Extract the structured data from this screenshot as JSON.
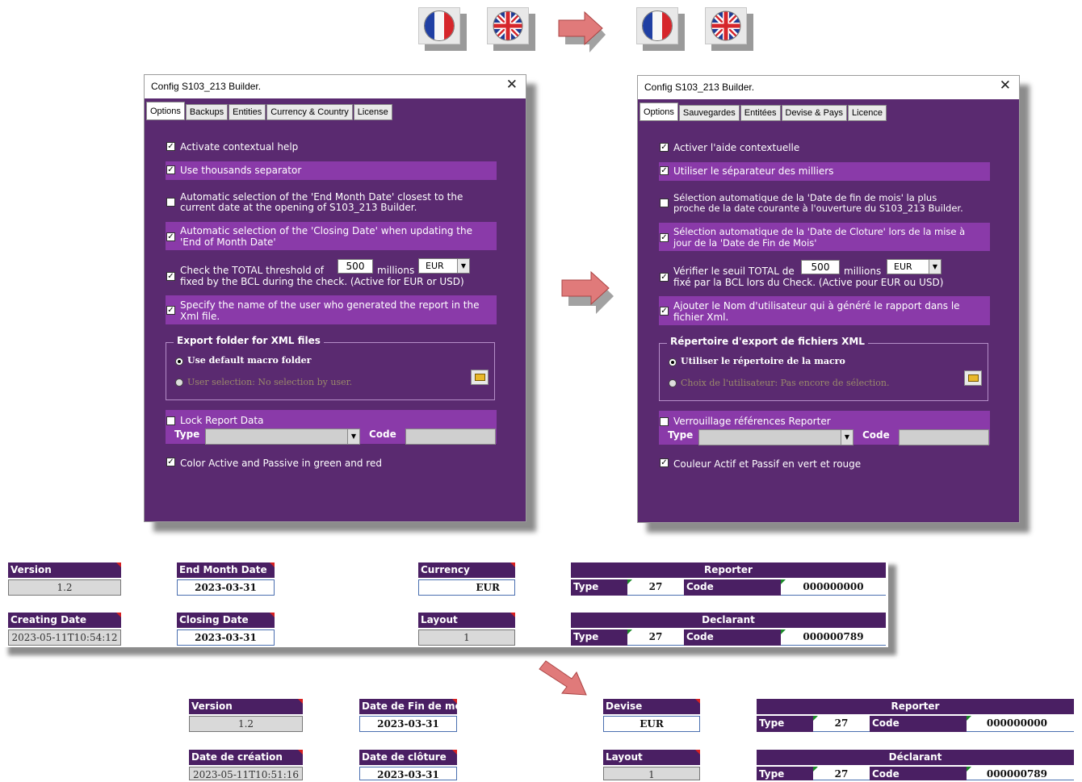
{
  "dialog_en": {
    "title": "Config S103_213 Builder.",
    "close_icon": "close-icon",
    "tabs": [
      "Options",
      "Backups",
      "Entities",
      "Currency & Country",
      "License"
    ],
    "opt_contextual_help": "Activate contextual help",
    "opt_thousands_sep": "Use thousands separator",
    "opt_auto_end_month_1": "Automatic selection of the 'End Month Date' closest to the",
    "opt_auto_end_month_2": "current date at the opening of S103_213 Builder.",
    "opt_auto_closing_1": "Automatic selection of the 'Closing Date' when updating the",
    "opt_auto_closing_2": "'End of Month Date'",
    "opt_threshold_pre": "Check the TOTAL threshold of",
    "threshold_value": "500",
    "opt_threshold_mid": "millions",
    "threshold_currency": "EUR",
    "opt_threshold_2": "fixed by the BCL during the check. (Active for EUR or USD)",
    "opt_user_name_1": "Specify the name of the user who generated the report in the",
    "opt_user_name_2": "Xml file.",
    "export_title": "Export folder for XML files",
    "export_default": "Use default macro folder",
    "export_user": "User selection: No selection by user.",
    "lock_label": "Lock Report Data",
    "type_label": "Type",
    "code_label": "Code",
    "color_label": "Color Active and Passive in green and red"
  },
  "dialog_fr": {
    "title": "Config S103_213 Builder.",
    "tabs": [
      "Options",
      "Sauvegardes",
      "Entitées",
      "Devise & Pays",
      "Licence"
    ],
    "opt_contextual_help": "Activer l'aide contextuelle",
    "opt_thousands_sep": "Utiliser le séparateur des milliers",
    "opt_auto_end_month_1": "Sélection automatique de la  'Date de fin de mois'  la plus",
    "opt_auto_end_month_2": "proche de la date courante à l'ouverture du S103_213 Builder.",
    "opt_auto_closing_1": "Sélection automatique de la 'Date de Cloture' lors de la mise à",
    "opt_auto_closing_2": "jour de la 'Date de Fin de Mois'",
    "opt_threshold_pre": "Vérifier le seuil TOTAL de",
    "threshold_value": "500",
    "opt_threshold_mid": "millions",
    "threshold_currency": "EUR",
    "opt_threshold_2": "fixé par la BCL lors du Check. (Active pour EUR ou USD)",
    "opt_user_name_1": "Ajouter le Nom d'utilisateur qui à généré le rapport dans le",
    "opt_user_name_2": "fichier Xml.",
    "export_title": "Répertoire d'export de fichiers XML",
    "export_default": "Utiliser le répertoire de la macro",
    "export_user": "Choix de l'utilisateur: Pas encore de sélection.",
    "lock_label": "Verrouillage références Reporter",
    "type_label": "Type",
    "code_label": "Code",
    "color_label": "Couleur Actif et Passif en vert et rouge"
  },
  "sheet_en": {
    "version_label": "Version",
    "version_value": "1.2",
    "end_month_label": "End Month Date",
    "end_month_value": "2023-03-31",
    "currency_label": "Currency",
    "currency_value": "EUR",
    "reporter_label": "Reporter",
    "reporter_type_label": "Type",
    "reporter_type_value": "27",
    "reporter_code_label": "Code",
    "reporter_code_value": "000000000",
    "creating_label": "Creating Date",
    "creating_value": "2023-05-11T10:54:12",
    "closing_label": "Closing Date",
    "closing_value": "2023-03-31",
    "layout_label": "Layout",
    "layout_value": "1",
    "declarant_label": "Declarant",
    "declarant_type_label": "Type",
    "declarant_type_value": "27",
    "declarant_code_label": "Code",
    "declarant_code_value": "000000789"
  },
  "sheet_fr": {
    "version_label": "Version",
    "version_value": "1.2",
    "end_month_label": "Date de Fin de mois",
    "end_month_value": "2023-03-31",
    "currency_label": "Devise",
    "currency_value": "EUR",
    "reporter_label": "Reporter",
    "reporter_type_label": "Type",
    "reporter_type_value": "27",
    "reporter_code_label": "Code",
    "reporter_code_value": "000000000",
    "creating_label": "Date de création",
    "creating_value": "2023-05-11T10:51:16",
    "closing_label": "Date de clôture",
    "closing_value": "2023-03-31",
    "layout_label": "Layout",
    "layout_value": "1",
    "declarant_label": "Déclarant",
    "declarant_type_label": "Type",
    "declarant_type_value": "27",
    "declarant_code_label": "Code",
    "declarant_code_value": "000000789"
  },
  "colors": {
    "dialog_bg": "#5a2a70",
    "band_bg": "#8a3aa9",
    "header_cell": "#4a1f63",
    "arrow": "#e07070"
  }
}
